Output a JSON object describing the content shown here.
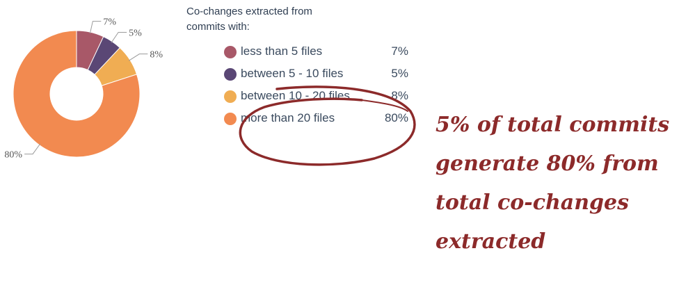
{
  "chart_data": {
    "type": "pie",
    "variant": "donut",
    "title": "Co-changes extracted from commits with:",
    "legend_placement": "right",
    "slices": [
      {
        "label": "less than 5 files",
        "value": 7,
        "display": "7%",
        "color": "#a85868"
      },
      {
        "label": "between 5 - 10 files",
        "value": 5,
        "display": "5%",
        "color": "#5a4775"
      },
      {
        "label": "between 10 - 20 files",
        "value": 8,
        "display": "8%",
        "color": "#f0ad53"
      },
      {
        "label": "more than 20 files",
        "value": 80,
        "display": "80%",
        "color": "#f28a50"
      }
    ]
  },
  "annotation": {
    "color": "#8c2a2a",
    "lines": [
      "5% of total commits",
      "generate 80% from",
      "total co-changes",
      "extracted"
    ]
  }
}
